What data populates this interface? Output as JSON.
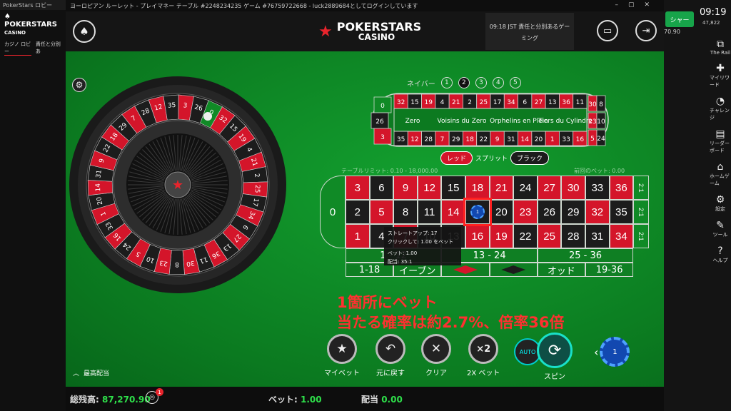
{
  "lobby": {
    "title": "PokerStars ロビー",
    "tabs": [
      "カジノ ロビー",
      "責任と分別あ"
    ],
    "clock": "09:19",
    "balance_short": "70.90",
    "points": "47,822",
    "cashier_label": "シャー",
    "side": [
      {
        "label": "The Rail",
        "icon": "rail-icon"
      },
      {
        "label": "マイリワード",
        "icon": "reward-icon"
      },
      {
        "label": "チャレンジ",
        "icon": "challenge-icon"
      },
      {
        "label": "リーダーボード",
        "icon": "leaderboard-icon"
      },
      {
        "label": "ホームゲーム",
        "icon": "home-icon"
      },
      {
        "label": "設定",
        "icon": "gear-icon"
      },
      {
        "label": "ツール",
        "icon": "tool-icon"
      },
      {
        "label": "ヘルプ",
        "icon": "help-icon"
      }
    ]
  },
  "window": {
    "title": "ヨーロピアン ルーレット - プレイマネー テーブル #2248234235 ゲーム #76759722668 - luck2889684としてログインしています"
  },
  "header": {
    "brand": "POKERSTARS",
    "brand_sub": "CASINO",
    "notice_line1": "09:18 JST 責任と分別あるゲー",
    "notice_line2": "ミング"
  },
  "racetrack": {
    "neighbors_label": "ネイバー",
    "neighbor_options": [
      "1",
      "2",
      "3",
      "4",
      "5"
    ],
    "selected_neighbor": "2",
    "top_numbers": [
      "32",
      "15",
      "19",
      "4",
      "21",
      "2",
      "25",
      "17",
      "34",
      "6",
      "27",
      "13",
      "36",
      "11"
    ],
    "bottom_numbers": [
      "35",
      "12",
      "28",
      "7",
      "29",
      "18",
      "22",
      "9",
      "31",
      "14",
      "20",
      "1",
      "33",
      "16"
    ],
    "left_numbers": [
      "0",
      "26",
      "3"
    ],
    "right_numbers": [
      "30",
      "8",
      "23",
      "10",
      "5",
      "24"
    ],
    "sections": [
      "Zero",
      "Voisins du Zero",
      "Orphelins en Plein",
      "Tiers du Cylindre"
    ],
    "red_label": "レッド",
    "split_label": "スプリット",
    "black_label": "ブラック"
  },
  "table": {
    "limit_label": "テーブルリミット: 0.10 - 18,000.00",
    "last_bet_label": "前回のベット: 0.00",
    "zero": "0",
    "rows": [
      [
        "3",
        "6",
        "9",
        "12",
        "15",
        "18",
        "21",
        "24",
        "27",
        "30",
        "33",
        "36"
      ],
      [
        "2",
        "5",
        "8",
        "11",
        "14",
        "17",
        "20",
        "23",
        "26",
        "29",
        "32",
        "35"
      ],
      [
        "1",
        "4",
        "7",
        "10",
        "13",
        "16",
        "19",
        "22",
        "25",
        "28",
        "31",
        "34"
      ]
    ],
    "columns": [
      "2:1",
      "2:1",
      "2:1"
    ],
    "dozens": [
      "1 - 12",
      "13 - 24",
      "25 - 36"
    ],
    "outside": [
      "1-18",
      "イーブン",
      "red-diamond",
      "black-diamond",
      "オッド",
      "19-36"
    ],
    "chip_value": "1"
  },
  "tooltip": {
    "line1": "ストレートアップ: 17",
    "line2": "クリックして: 1.00 をベット",
    "line3": "ベット: 1.00",
    "line4": "配当: 35:1"
  },
  "annotation": {
    "line1": "1箇所にベット",
    "line2": "当たる確率は約2.7%、倍率36倍"
  },
  "wheel": {
    "numbers": [
      "0",
      "32",
      "15",
      "19",
      "4",
      "21",
      "2",
      "25",
      "17",
      "34",
      "6",
      "27",
      "13",
      "36",
      "11",
      "30",
      "8",
      "23",
      "10",
      "5",
      "24",
      "16",
      "33",
      "1",
      "20",
      "14",
      "31",
      "9",
      "22",
      "18",
      "29",
      "7",
      "28",
      "12",
      "35",
      "3",
      "26"
    ]
  },
  "controls": {
    "my_bet": "マイベット",
    "undo": "元に戻す",
    "clear": "クリア",
    "double": "2X ベット",
    "double_icon": "×2",
    "auto": "AUTO",
    "spin": "スピン",
    "chip_value": "1",
    "max_bet": "最高配当"
  },
  "footer": {
    "balance_label": "総残高:",
    "balance_value": "87,270.90",
    "bet_label": "ベット:",
    "bet_value": "1.00",
    "payout_label": "配当",
    "payout_value": "0.00",
    "badge": "1"
  },
  "colors": {
    "red": "#d4152a",
    "black": "#1c1c1c",
    "felt": "#0f8a26",
    "accent": "#e8242c",
    "annotation": "#ff3030"
  }
}
